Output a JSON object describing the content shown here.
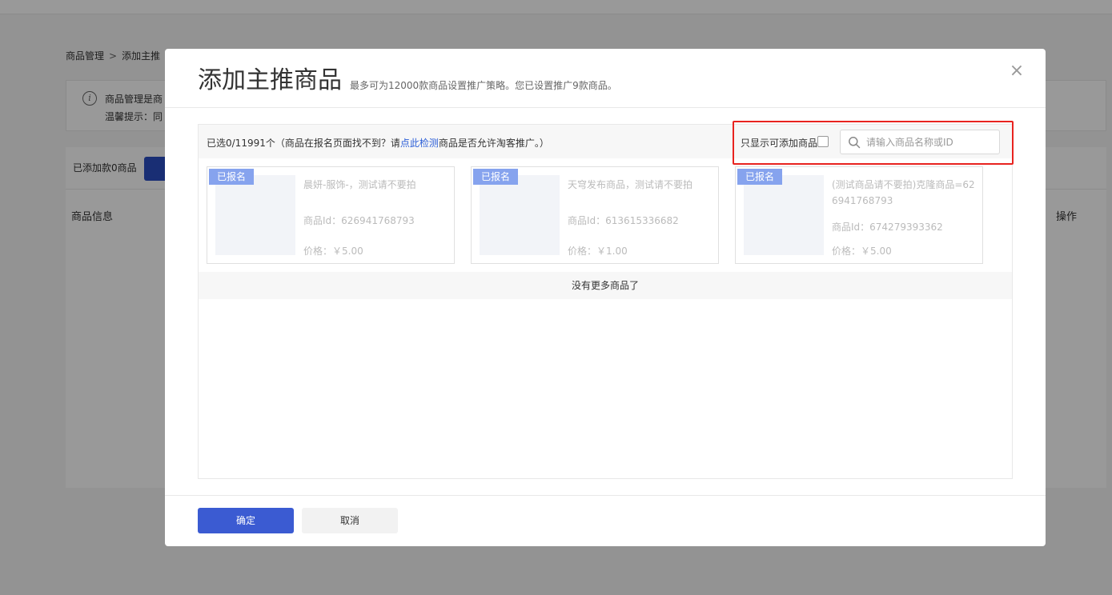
{
  "background": {
    "breadcrumb": {
      "root": "商品管理",
      "separator": ">",
      "current": "添加主推"
    },
    "notice": {
      "line1": "商品管理是商",
      "line2": "温馨提示：同"
    },
    "added_count": "已添加款0商品",
    "columns": {
      "info": "商品信息",
      "operation": "操作"
    }
  },
  "modal": {
    "title": "添加主推商品",
    "subtitle": "最多可为12000款商品设置推广策略。您已设置推广9款商品。",
    "close_glyph": "×",
    "selected": {
      "prefix": "已选0/11991个（商品在报名页面找不到？请",
      "link": "点此检测",
      "suffix": "商品是否允许淘客推广。）"
    },
    "filter_label": "只显示可添加商品",
    "search": {
      "placeholder": "请输入商品名称或ID"
    },
    "products": [
      {
        "badge": "已报名",
        "name": "晨妍-服饰-，测试请不要拍",
        "id": "商品Id：626941768793",
        "price": "价格：￥5.00"
      },
      {
        "badge": "已报名",
        "name": "天穹发布商品，测试请不要拍",
        "id": "商品Id：613615336682",
        "price": "价格：￥1.00"
      },
      {
        "badge": "已报名",
        "name": "(测试商品请不要拍)克隆商品=626941768793",
        "id": "商品Id：674279393362",
        "price": "价格：￥5.00"
      }
    ],
    "no_more": "没有更多商品了",
    "footer": {
      "ok": "确定",
      "cancel": "取消"
    }
  },
  "colors": {
    "primary": "#3b5bd2",
    "badge": "#86a3ee",
    "highlight": "#e8231f",
    "link": "#2b5ed7"
  }
}
